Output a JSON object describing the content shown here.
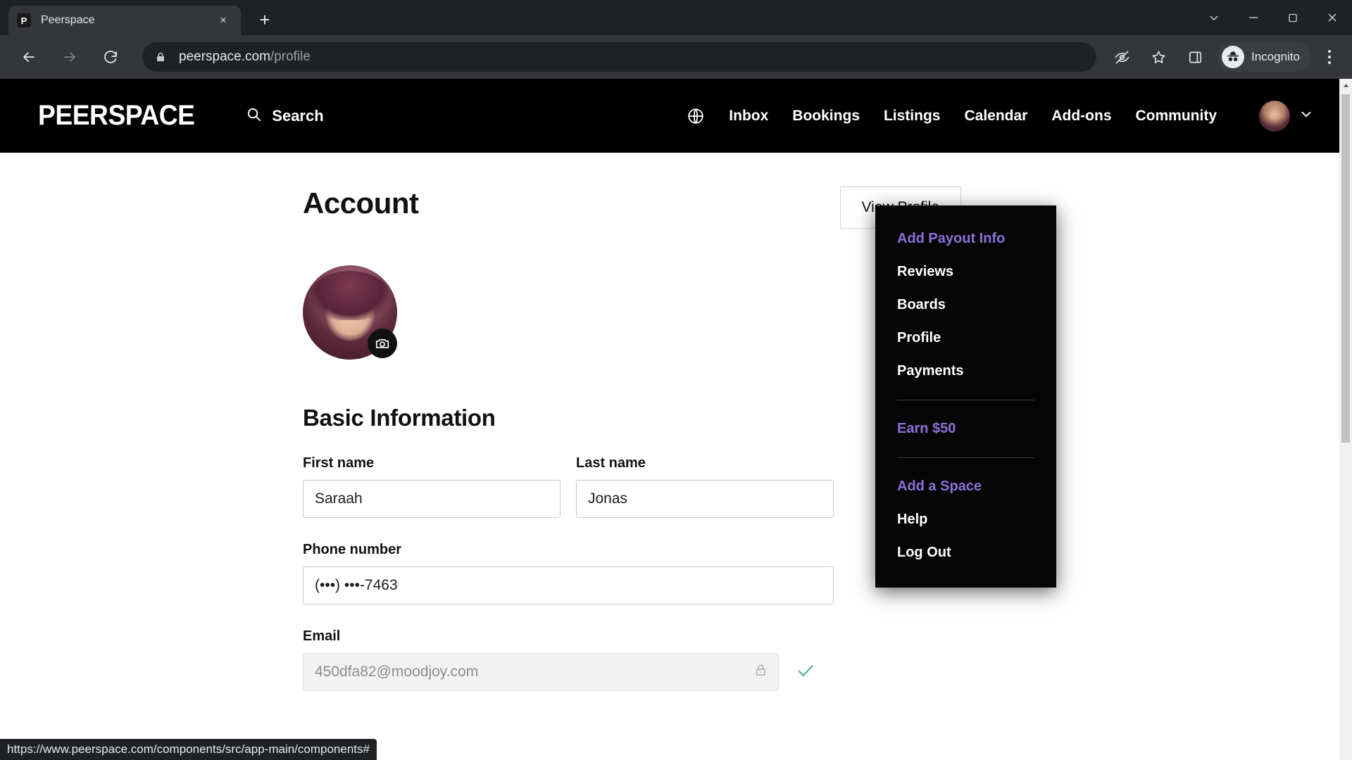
{
  "browser": {
    "tab": {
      "title": "Peerspace",
      "favicon_letter": "P",
      "close_label": "×"
    },
    "new_tab_label": "+",
    "window_controls": {
      "minimize": "—",
      "maximize": "❐",
      "close": "✕",
      "chevron": "⌄"
    },
    "nav": {
      "back": "←",
      "forward": "→",
      "reload": "↻"
    },
    "omnibox": {
      "url_host": "peerspace.com",
      "url_path": "/profile",
      "lock_icon": "lock-icon"
    },
    "toolbar_icons": [
      "eye-off-icon",
      "star-icon",
      "side-panel-icon"
    ],
    "incognito_label": "Incognito",
    "menu_label": "kebab-menu"
  },
  "status_bar": {
    "url": "https://www.peerspace.com/components/src/app-main/components#"
  },
  "site_header": {
    "logo": "PEERSPACE",
    "search_label": "Search",
    "nav_links": [
      "Inbox",
      "Bookings",
      "Listings",
      "Calendar",
      "Add-ons",
      "Community"
    ],
    "globe_icon": "globe-icon",
    "chevron_icon": "chevron-down-icon"
  },
  "dropdown": {
    "items": [
      {
        "label": "Add Payout Info",
        "accent": true
      },
      {
        "label": "Reviews",
        "accent": false
      },
      {
        "label": "Boards",
        "accent": false
      },
      {
        "label": "Profile",
        "accent": false
      },
      {
        "label": "Payments",
        "accent": false
      }
    ],
    "earn": {
      "label": "Earn $50",
      "accent": true
    },
    "bottom": [
      {
        "label": "Add a Space",
        "accent": true
      },
      {
        "label": "Help",
        "accent": false
      },
      {
        "label": "Log Out",
        "accent": false
      }
    ],
    "accent_color": "#8b72d9"
  },
  "page": {
    "title": "Account",
    "view_profile_button": "View Profile",
    "avatar_camera_icon": "camera-icon",
    "section_title": "Basic Information",
    "fields": {
      "first_name": {
        "label": "First name",
        "value": "Saraah"
      },
      "last_name": {
        "label": "Last name",
        "value": "Jonas"
      },
      "phone": {
        "label": "Phone number",
        "value": "(•••) •••-7463"
      },
      "email": {
        "label": "Email",
        "value": "450dfa82@moodjoy.com",
        "locked": true,
        "verified": true
      }
    }
  },
  "scrollbar": {
    "up_arrow": "▲"
  }
}
